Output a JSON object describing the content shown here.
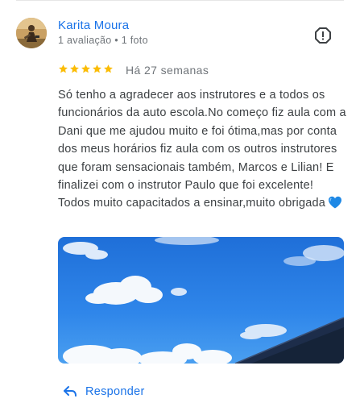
{
  "review": {
    "author_name": "Karita Moura",
    "author_meta": "1 avaliação • 1 foto",
    "rating": 5,
    "time": "Há 27 semanas",
    "text": "Só tenho a agradecer aos instrutores e a todos os funcionários da auto escola.No começo fiz aula com a Dani que me ajudou muito e foi ótima,mas por conta dos meus horários fiz aula com os outros instrutores que foram sensacionais também, Marcos e Lilian! E finalizei com o instrutor Paulo que foi excelente! Todos muito capacitados a ensinar,muito obrigada",
    "emoji": "blue-heart-emoji",
    "photo": "review-photo-sky-with-clouds"
  },
  "actions": {
    "reply_label": "Responder"
  },
  "icons": {
    "report": "report-flag-icon",
    "reply": "reply-arrow-icon",
    "star": "star-icon"
  },
  "colors": {
    "link_blue": "#1a73e8",
    "star_gold": "#fbbc04",
    "meta_gray": "#70757a",
    "text": "#3c4043",
    "heart_blue": "#1e88e5"
  }
}
